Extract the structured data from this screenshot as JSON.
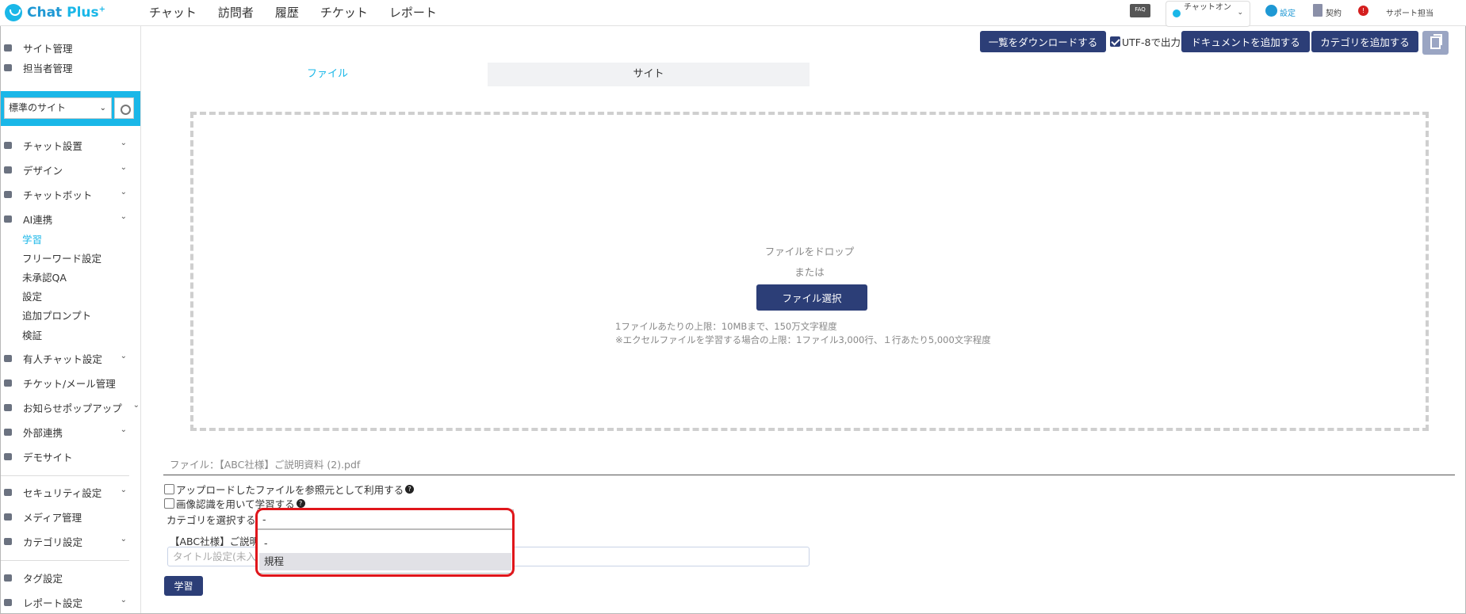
{
  "app": {
    "brand_chat": "Chat",
    "brand_plus": "Plus",
    "brand_sup": "+"
  },
  "topnav": [
    "チャット",
    "訪問者",
    "履歴",
    "チケット",
    "レポート"
  ],
  "topbar_right": {
    "faq": "FAQ",
    "status": "チャットオン",
    "settings": "設定",
    "contract": "契約",
    "alert": "!",
    "support": "サポート担当"
  },
  "sidebar": {
    "site_management": "サイト管理",
    "staff_management": "担当者管理",
    "site_select": "標準のサイト",
    "chat_settings": "チャット設置",
    "design": "デザイン",
    "chatbot": "チャットボット",
    "ai": "AI連携",
    "ai_sub": [
      "学習",
      "フリーワード設定",
      "未承認QA",
      "設定",
      "追加プロンプト",
      "検証"
    ],
    "manned_chat": "有人チャット設定",
    "ticket_mail": "チケット/メール管理",
    "notice_popup": "お知らせポップアップ",
    "external": "外部連携",
    "demo_site": "デモサイト",
    "security": "セキュリティ設定",
    "media": "メディア管理",
    "category": "カテゴリ設定",
    "tag": "タグ設定",
    "report": "レポート設定"
  },
  "actions": {
    "download": "一覧をダウンロードする",
    "utf8": "UTF-8で出力",
    "add_document": "ドキュメントを追加する",
    "add_category": "カテゴリを追加する"
  },
  "tabs": {
    "file": "ファイル",
    "site": "サイト"
  },
  "dropzone": {
    "title": "ファイルをドロップ",
    "or": "または",
    "button": "ファイル選択",
    "note1": "1ファイルあたりの上限：10MBまで、150万文字程度",
    "note2": "※エクセルファイルを学習する場合の上限：1ファイル3,000行、１行あたり5,000文字程度"
  },
  "form": {
    "filename": "ファイル：【ABC社様】ご説明資料 (2).pdf",
    "opt_reference": "アップロードしたファイルを参照元として利用する",
    "opt_image": "画像認識を用いて学習する",
    "help": "?",
    "category_label": "カテゴリを選択する",
    "category_value": "-",
    "category_options": [
      "-",
      "規程"
    ],
    "title_label": "【ABC社様】ご説明",
    "title_placeholder": "タイトル設定(未入",
    "learn_button": "学習"
  }
}
